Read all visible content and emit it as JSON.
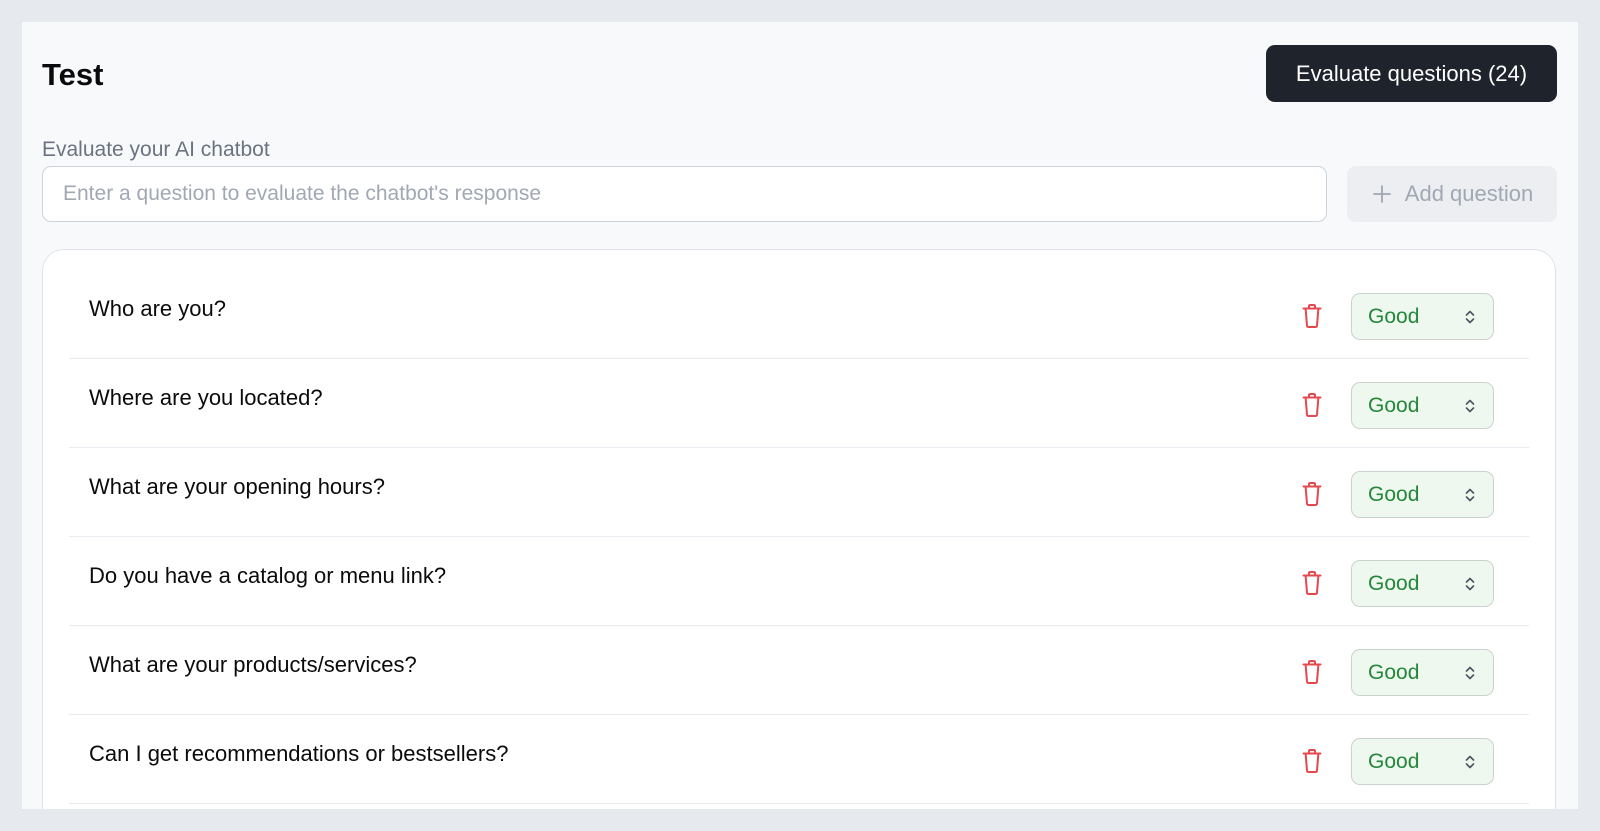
{
  "header": {
    "title": "Test",
    "subtitle": "Evaluate your AI chatbot",
    "evaluate_label": "Evaluate questions (24)"
  },
  "input": {
    "placeholder": "Enter a question to evaluate the chatbot's response",
    "value": ""
  },
  "add_button": {
    "label": "Add question",
    "icon": "plus-icon"
  },
  "questions": [
    {
      "text": "Who are you?",
      "rating": "Good"
    },
    {
      "text": "Where are you located?",
      "rating": "Good"
    },
    {
      "text": "What are your opening hours?",
      "rating": "Good"
    },
    {
      "text": "Do you have a catalog or menu link?",
      "rating": "Good"
    },
    {
      "text": "What are your products/services?",
      "rating": "Good"
    },
    {
      "text": "Can I get recommendations or bestsellers?",
      "rating": "Good"
    }
  ],
  "icons": {
    "delete": "trash-icon",
    "rating_toggle": "chevron-up-down-icon"
  },
  "colors": {
    "primary_button": "#1f232b",
    "delete_icon": "#e5484d",
    "rating_text": "#25873b",
    "rating_background": "#eef8ef"
  }
}
